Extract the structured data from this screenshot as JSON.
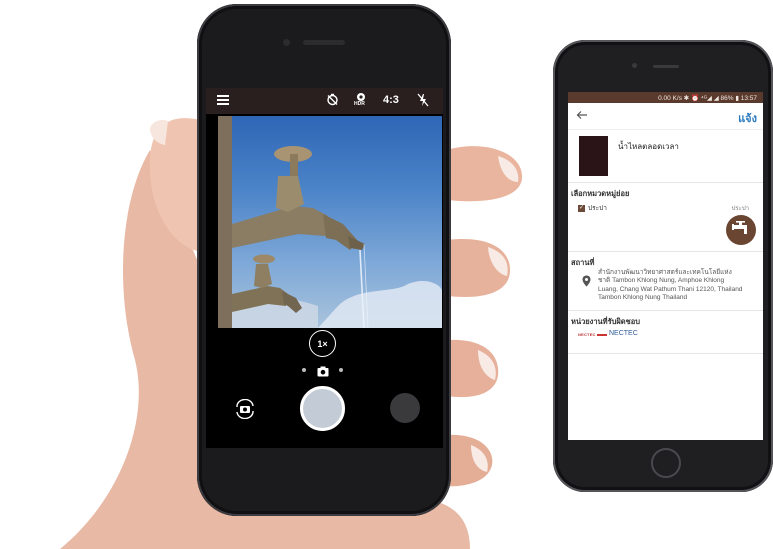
{
  "camera": {
    "topbar": {
      "menu_icon": "menu-icon",
      "timer_icon": "timer-off-icon",
      "hdr_label": "HDR",
      "aspect_ratio": "4:3",
      "flash_icon": "flash-off-icon"
    },
    "zoom_label": "1×",
    "mode_icon": "camera-icon",
    "switch_icon": "switch-camera-icon",
    "shutter_icon": "shutter-button",
    "gallery_icon": "gallery-thumbnail"
  },
  "app": {
    "status_bar": "0.00 K/s ✱ ⏰ ⁴ᴳ◢ ◢ 86% ▮ 13:57",
    "back_icon": "back-arrow-icon",
    "report_label": "แจ้ง",
    "photo_caption": "น้ำไหลตลอดเวลา",
    "category": {
      "title": "เลือกหมวดหมู่ย่อย",
      "checkbox_label": "ประปา",
      "selected_label": "ประปา",
      "icon": "faucet-icon"
    },
    "location": {
      "title": "สถานที่",
      "pin_icon": "location-pin-icon",
      "lines": [
        "สำนักงานพัฒนาวิทยาศาสตร์และเทคโนโลยีแห่ง",
        "ชาติ Tambon Khlong Nung, Amphoe Khlong",
        "Luang, Chang Wat Pathum Thani 12120, Thailand",
        "Tambon Khlong Nung Thailand"
      ]
    },
    "agency": {
      "title": "หน่วยงานที่รับผิดชอบ",
      "logo_text": "NECTEC",
      "name": "NECTEC"
    }
  }
}
